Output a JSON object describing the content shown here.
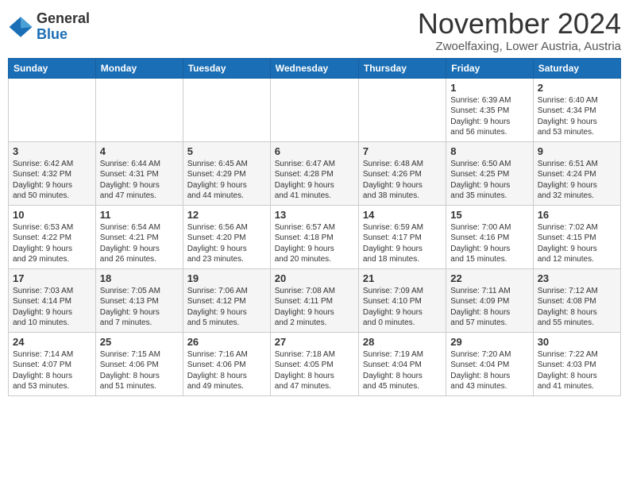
{
  "logo": {
    "general": "General",
    "blue": "Blue"
  },
  "header": {
    "month": "November 2024",
    "location": "Zwoelfaxing, Lower Austria, Austria"
  },
  "weekdays": [
    "Sunday",
    "Monday",
    "Tuesday",
    "Wednesday",
    "Thursday",
    "Friday",
    "Saturday"
  ],
  "weeks": [
    [
      {
        "day": "",
        "info": ""
      },
      {
        "day": "",
        "info": ""
      },
      {
        "day": "",
        "info": ""
      },
      {
        "day": "",
        "info": ""
      },
      {
        "day": "",
        "info": ""
      },
      {
        "day": "1",
        "info": "Sunrise: 6:39 AM\nSunset: 4:35 PM\nDaylight: 9 hours\nand 56 minutes."
      },
      {
        "day": "2",
        "info": "Sunrise: 6:40 AM\nSunset: 4:34 PM\nDaylight: 9 hours\nand 53 minutes."
      }
    ],
    [
      {
        "day": "3",
        "info": "Sunrise: 6:42 AM\nSunset: 4:32 PM\nDaylight: 9 hours\nand 50 minutes."
      },
      {
        "day": "4",
        "info": "Sunrise: 6:44 AM\nSunset: 4:31 PM\nDaylight: 9 hours\nand 47 minutes."
      },
      {
        "day": "5",
        "info": "Sunrise: 6:45 AM\nSunset: 4:29 PM\nDaylight: 9 hours\nand 44 minutes."
      },
      {
        "day": "6",
        "info": "Sunrise: 6:47 AM\nSunset: 4:28 PM\nDaylight: 9 hours\nand 41 minutes."
      },
      {
        "day": "7",
        "info": "Sunrise: 6:48 AM\nSunset: 4:26 PM\nDaylight: 9 hours\nand 38 minutes."
      },
      {
        "day": "8",
        "info": "Sunrise: 6:50 AM\nSunset: 4:25 PM\nDaylight: 9 hours\nand 35 minutes."
      },
      {
        "day": "9",
        "info": "Sunrise: 6:51 AM\nSunset: 4:24 PM\nDaylight: 9 hours\nand 32 minutes."
      }
    ],
    [
      {
        "day": "10",
        "info": "Sunrise: 6:53 AM\nSunset: 4:22 PM\nDaylight: 9 hours\nand 29 minutes."
      },
      {
        "day": "11",
        "info": "Sunrise: 6:54 AM\nSunset: 4:21 PM\nDaylight: 9 hours\nand 26 minutes."
      },
      {
        "day": "12",
        "info": "Sunrise: 6:56 AM\nSunset: 4:20 PM\nDaylight: 9 hours\nand 23 minutes."
      },
      {
        "day": "13",
        "info": "Sunrise: 6:57 AM\nSunset: 4:18 PM\nDaylight: 9 hours\nand 20 minutes."
      },
      {
        "day": "14",
        "info": "Sunrise: 6:59 AM\nSunset: 4:17 PM\nDaylight: 9 hours\nand 18 minutes."
      },
      {
        "day": "15",
        "info": "Sunrise: 7:00 AM\nSunset: 4:16 PM\nDaylight: 9 hours\nand 15 minutes."
      },
      {
        "day": "16",
        "info": "Sunrise: 7:02 AM\nSunset: 4:15 PM\nDaylight: 9 hours\nand 12 minutes."
      }
    ],
    [
      {
        "day": "17",
        "info": "Sunrise: 7:03 AM\nSunset: 4:14 PM\nDaylight: 9 hours\nand 10 minutes."
      },
      {
        "day": "18",
        "info": "Sunrise: 7:05 AM\nSunset: 4:13 PM\nDaylight: 9 hours\nand 7 minutes."
      },
      {
        "day": "19",
        "info": "Sunrise: 7:06 AM\nSunset: 4:12 PM\nDaylight: 9 hours\nand 5 minutes."
      },
      {
        "day": "20",
        "info": "Sunrise: 7:08 AM\nSunset: 4:11 PM\nDaylight: 9 hours\nand 2 minutes."
      },
      {
        "day": "21",
        "info": "Sunrise: 7:09 AM\nSunset: 4:10 PM\nDaylight: 9 hours\nand 0 minutes."
      },
      {
        "day": "22",
        "info": "Sunrise: 7:11 AM\nSunset: 4:09 PM\nDaylight: 8 hours\nand 57 minutes."
      },
      {
        "day": "23",
        "info": "Sunrise: 7:12 AM\nSunset: 4:08 PM\nDaylight: 8 hours\nand 55 minutes."
      }
    ],
    [
      {
        "day": "24",
        "info": "Sunrise: 7:14 AM\nSunset: 4:07 PM\nDaylight: 8 hours\nand 53 minutes."
      },
      {
        "day": "25",
        "info": "Sunrise: 7:15 AM\nSunset: 4:06 PM\nDaylight: 8 hours\nand 51 minutes."
      },
      {
        "day": "26",
        "info": "Sunrise: 7:16 AM\nSunset: 4:06 PM\nDaylight: 8 hours\nand 49 minutes."
      },
      {
        "day": "27",
        "info": "Sunrise: 7:18 AM\nSunset: 4:05 PM\nDaylight: 8 hours\nand 47 minutes."
      },
      {
        "day": "28",
        "info": "Sunrise: 7:19 AM\nSunset: 4:04 PM\nDaylight: 8 hours\nand 45 minutes."
      },
      {
        "day": "29",
        "info": "Sunrise: 7:20 AM\nSunset: 4:04 PM\nDaylight: 8 hours\nand 43 minutes."
      },
      {
        "day": "30",
        "info": "Sunrise: 7:22 AM\nSunset: 4:03 PM\nDaylight: 8 hours\nand 41 minutes."
      }
    ]
  ]
}
